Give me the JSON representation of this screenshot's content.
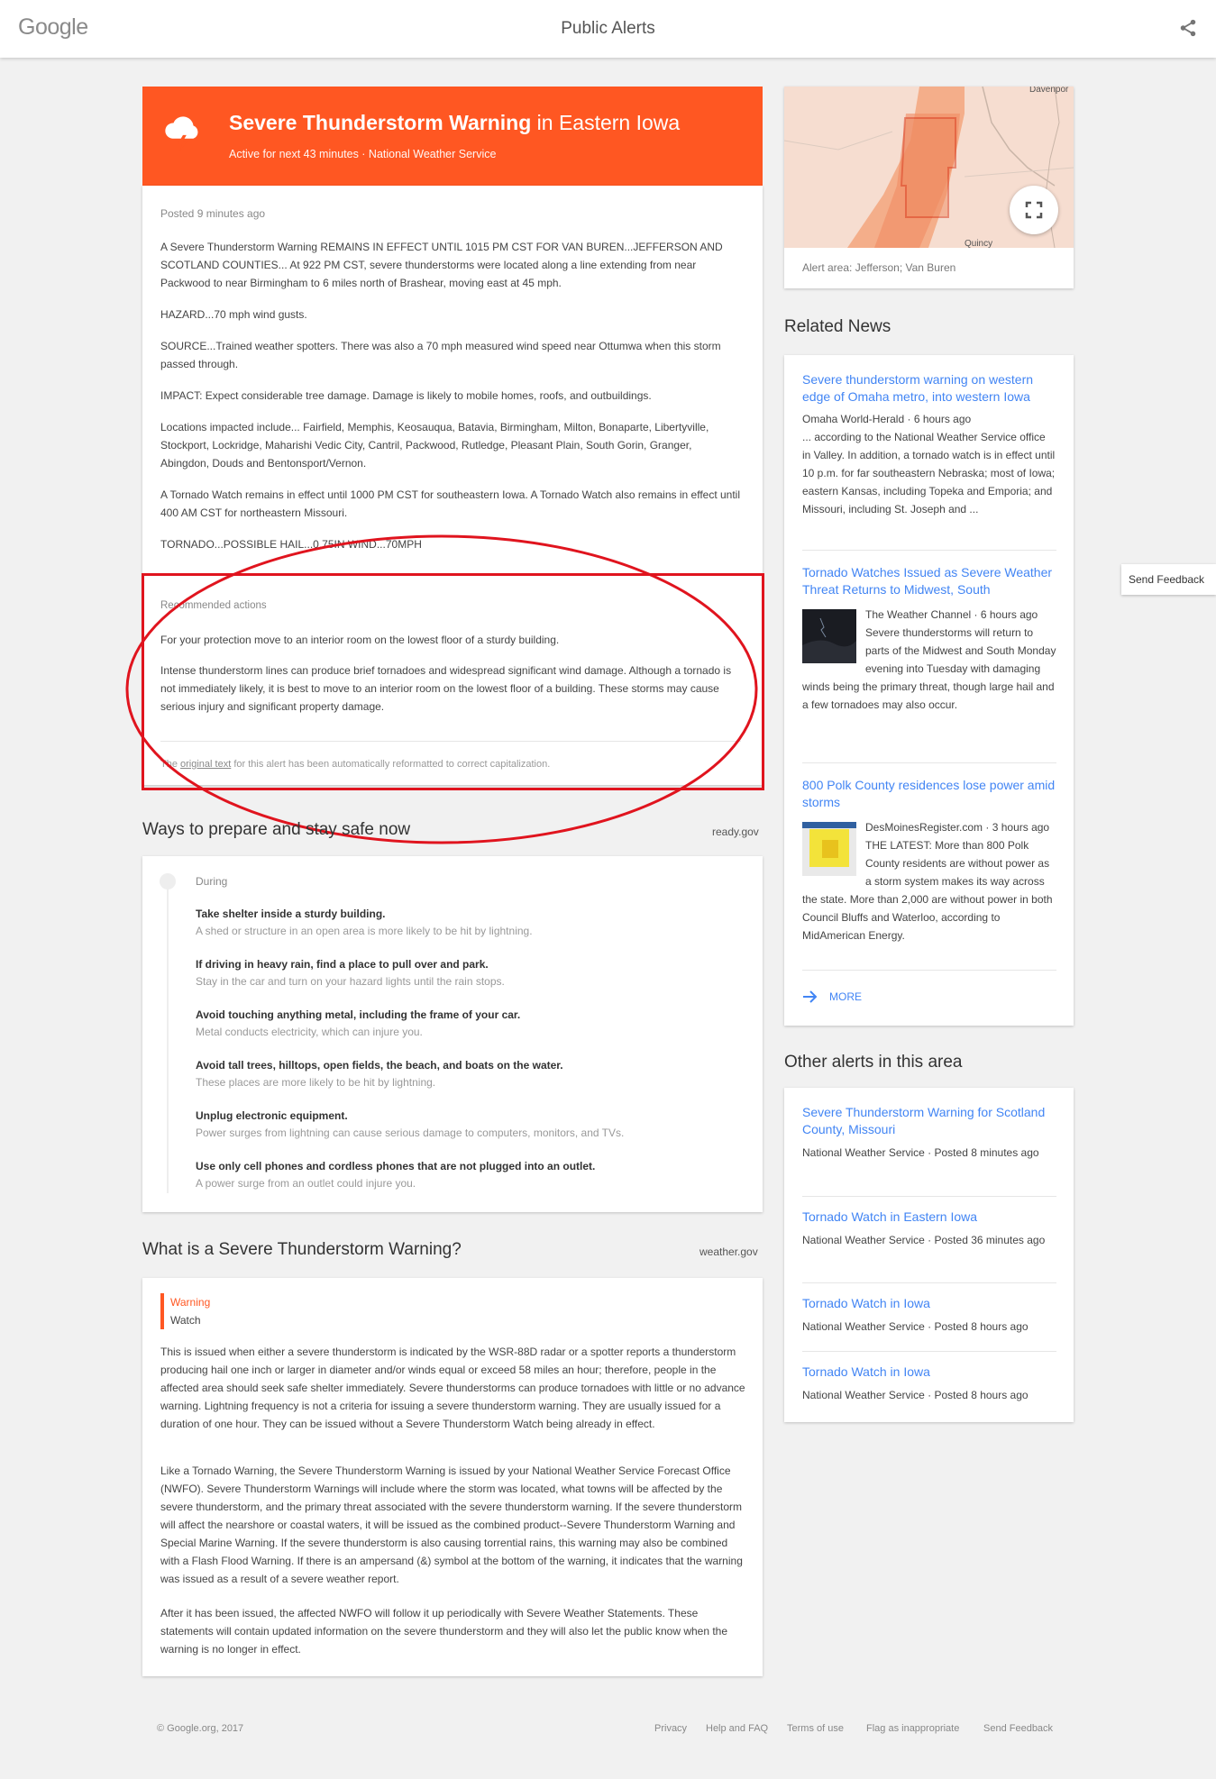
{
  "header": {
    "logo": "Google",
    "title": "Public Alerts"
  },
  "alert": {
    "title": "Severe Thunderstorm Warning",
    "region": "in Eastern Iowa",
    "subtitle": "Active for next 43 minutes · National Weather Service",
    "posted": "Posted 9 minutes ago",
    "paragraphs": [
      "A Severe Thunderstorm Warning REMAINS IN EFFECT UNTIL 1015 PM CST FOR VAN BUREN...JEFFERSON AND SCOTLAND COUNTIES... At 922 PM CST, severe thunderstorms were located along a line extending from near Packwood to near Birmingham to 6 miles north of Brashear, moving east at 45 mph.",
      "HAZARD...70 mph wind gusts.",
      "SOURCE...Trained weather spotters. There was also a 70 mph measured wind speed near Ottumwa when this storm passed through.",
      "IMPACT: Expect considerable tree damage. Damage is likely to mobile homes, roofs, and outbuildings.",
      "Locations impacted include... Fairfield, Memphis, Keosauqua, Batavia, Birmingham, Milton, Bonaparte, Libertyville, Stockport, Lockridge, Maharishi Vedic City, Cantril, Packwood, Rutledge, Pleasant Plain, South Gorin, Granger, Abingdon, Douds and Bentonsport/Vernon.",
      "A Tornado Watch remains in effect until 1000 PM CST for southeastern Iowa. A Tornado Watch also remains in effect until 400 AM CST for northeastern Missouri.",
      "TORNADO...POSSIBLE HAIL...0.75IN WIND...70MPH"
    ],
    "recommended_label": "Recommended actions",
    "recommended": [
      "For your protection move to an interior room on the lowest floor of a sturdy building.",
      "Intense thunderstorm lines can produce brief tornadoes and widespread significant wind damage. Although a tornado is not immediately likely, it is best to move to an interior room on the lowest floor of a building. These storms may cause serious injury and significant property damage."
    ],
    "footnote_prefix": "The ",
    "footnote_link": "original text",
    "footnote_suffix": " for this alert has been automatically reformatted to correct capitalization."
  },
  "ways": {
    "title": "Ways to prepare and stay safe now",
    "source": "ready.gov",
    "phase": "During",
    "tips": [
      {
        "title": "Take shelter inside a sturdy building.",
        "desc": "A shed or structure in an open area is more likely to be hit by lightning."
      },
      {
        "title": "If driving in heavy rain, find a place to pull over and park.",
        "desc": "Stay in the car and turn on your hazard lights until the rain stops."
      },
      {
        "title": "Avoid touching anything metal, including the frame of your car.",
        "desc": "Metal conducts electricity, which can injure you."
      },
      {
        "title": "Avoid tall trees, hilltops, open fields, the beach, and boats on the water.",
        "desc": "These places are more likely to be hit by lightning."
      },
      {
        "title": "Unplug electronic equipment.",
        "desc": "Power surges from lightning can cause serious damage to computers, monitors, and TVs."
      },
      {
        "title": "Use only cell phones and cordless phones that are not plugged into an outlet.",
        "desc": "A power surge from an outlet could injure you."
      }
    ]
  },
  "what": {
    "title": "What is a Severe Thunderstorm Warning?",
    "source": "weather.gov",
    "tab_warning": "Warning",
    "tab_watch": "Watch",
    "paragraphs": [
      "This is issued when either a severe thunderstorm is indicated by the WSR-88D radar or a spotter reports a thunderstorm producing hail one inch or larger in diameter and/or winds equal or exceed 58 miles an hour; therefore, people in the affected area should seek safe shelter immediately. Severe thunderstorms can produce tornadoes with little or no advance warning. Lightning frequency is not a criteria for issuing a severe thunderstorm warning. They are usually issued for a duration of one hour. They can be issued without a Severe Thunderstorm Watch being already in effect.",
      "Like a Tornado Warning, the Severe Thunderstorm Warning is issued by your National Weather Service Forecast Office (NWFO). Severe Thunderstorm Warnings will include where the storm was located, what towns will be affected by the severe thunderstorm, and the primary threat associated with the severe thunderstorm warning. If the severe thunderstorm will affect the nearshore or coastal waters, it will be issued as the combined product--Severe Thunderstorm Warning and Special Marine Warning. If the severe thunderstorm is also causing torrential rains, this warning may also be combined with a Flash Flood Warning. If there is an ampersand (&) symbol at the bottom of the warning, it indicates that the warning was issued as a result of a severe weather report.",
      "After it has been issued, the affected NWFO will follow it up periodically with Severe Weather Statements. These statements will contain updated information on the severe thunderstorm and they will also let the public know when the warning is no longer in effect."
    ]
  },
  "map": {
    "label": "Alert area: Jefferson; Van Buren",
    "city_top": "Davenpor",
    "city_bottom": "Quincy"
  },
  "news": {
    "title": "Related News",
    "items": [
      {
        "headline": "Severe thunderstorm warning on western edge of Omaha metro, into western Iowa",
        "meta": "Omaha World-Herald · 6 hours ago",
        "body": "... according to the National Weather Service office in Valley. In addition, a tornado watch is in effect until 10 p.m. for far southeastern Nebraska; most of Iowa; eastern Kansas, including Topeka and Emporia; and Missouri, including St. Joseph and ..."
      },
      {
        "headline": "Tornado Watches Issued as Severe Weather Threat Returns to Midwest, South",
        "meta": "The Weather Channel · 6 hours ago",
        "body": "Severe thunderstorms will return to parts of the Midwest and South Monday evening into Tuesday with damaging winds being the primary threat, though large hail and a few tornadoes may also occur."
      },
      {
        "headline": "800 Polk County residences lose power amid storms",
        "meta": "DesMoinesRegister.com · 3 hours ago",
        "body": "THE LATEST: More than 800 Polk County residents are without power as a storm system makes its way across the state. More than 2,000 are without power in both Council Bluffs and Waterloo, according to MidAmerican Energy."
      }
    ],
    "more": "MORE"
  },
  "other": {
    "title": "Other alerts in this area",
    "items": [
      {
        "headline": "Severe Thunderstorm Warning for Scotland County, Missouri",
        "meta": "National Weather Service · Posted 8 minutes ago"
      },
      {
        "headline": "Tornado Watch in Eastern Iowa",
        "meta": "National Weather Service · Posted 36 minutes ago"
      },
      {
        "headline": "Tornado Watch in Iowa",
        "meta": "National Weather Service · Posted 8 hours ago"
      },
      {
        "headline": "Tornado Watch in Iowa",
        "meta": "National Weather Service · Posted 8 hours ago"
      }
    ]
  },
  "feedback_tab": "Send Feedback",
  "footer": {
    "copyright": "© Google.org, 2017",
    "links": [
      "Privacy",
      "Help and FAQ",
      "Terms of use",
      "Flag as inappropriate",
      "Send Feedback"
    ]
  },
  "colors": {
    "alert": "#ff5722",
    "link": "#4285f4",
    "annotation": "#e0141e"
  }
}
